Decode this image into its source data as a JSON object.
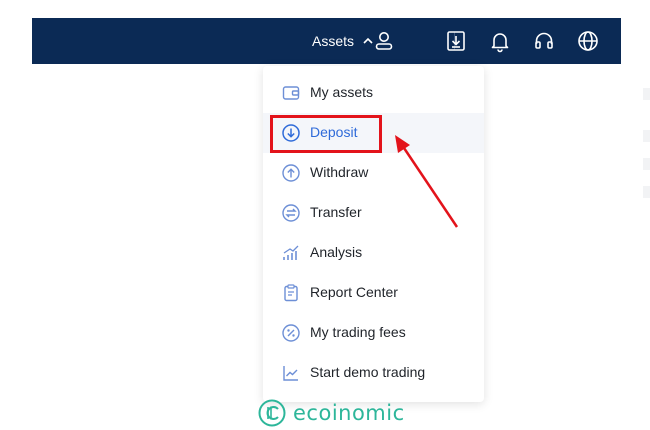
{
  "topbar": {
    "assets_label": "Assets",
    "icons": [
      "user-icon",
      "download-app-icon",
      "bell-icon",
      "headset-icon",
      "globe-icon"
    ]
  },
  "dropdown": {
    "items": [
      {
        "label": "My assets",
        "icon": "wallet-icon"
      },
      {
        "label": "Deposit",
        "icon": "deposit-icon"
      },
      {
        "label": "Withdraw",
        "icon": "withdraw-icon"
      },
      {
        "label": "Transfer",
        "icon": "transfer-icon"
      },
      {
        "label": "Analysis",
        "icon": "analysis-icon"
      },
      {
        "label": "Report Center",
        "icon": "report-icon"
      },
      {
        "label": "My trading fees",
        "icon": "fees-icon"
      },
      {
        "label": "Start demo trading",
        "icon": "demo-trading-icon"
      }
    ],
    "active_label": "Deposit"
  },
  "colors": {
    "topbar_bg": "#0b2a55",
    "accent": "#2f6bd9",
    "highlight_red": "#e3131b",
    "watermark": "#2db69a"
  },
  "watermark": {
    "text": "ecoinomic"
  }
}
